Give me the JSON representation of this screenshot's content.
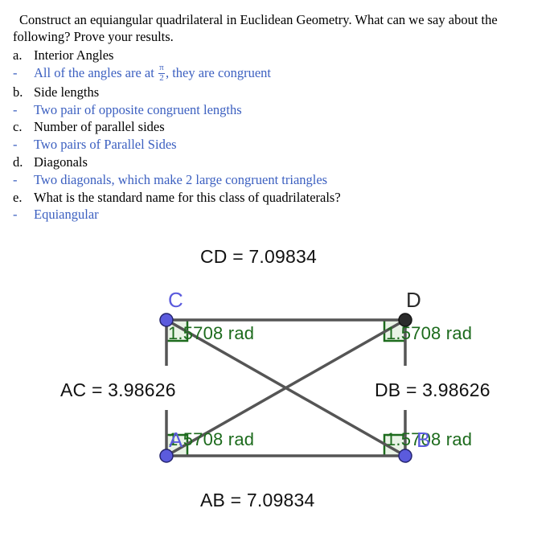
{
  "prompt": "Construct an equiangular quadrilateral in Euclidean Geometry.  What can we say about the following? Prove your results.",
  "qa": [
    {
      "marker": "a.",
      "kind": "question",
      "text": "Interior Angles"
    },
    {
      "marker": "-",
      "kind": "answer",
      "text_before": "All of the angles are at ",
      "fraction_num": "π",
      "fraction_den": "2",
      "text_after": ", they are congruent"
    },
    {
      "marker": "b.",
      "kind": "question",
      "text": "Side lengths"
    },
    {
      "marker": "-",
      "kind": "answer",
      "text": "Two pair of opposite congruent lengths"
    },
    {
      "marker": "c.",
      "kind": "question",
      "text": "Number of parallel sides"
    },
    {
      "marker": "-",
      "kind": "answer",
      "text": "Two pairs of Parallel Sides"
    },
    {
      "marker": "d.",
      "kind": "question",
      "text": "Diagonals"
    },
    {
      "marker": "-",
      "kind": "answer",
      "text": "Two diagonals, which make 2 large congruent triangles"
    },
    {
      "marker": "e.",
      "kind": "question",
      "text": "What is the standard name for this class of quadrilaterals?"
    },
    {
      "marker": "-",
      "kind": "answer",
      "text": "Equiangular"
    }
  ],
  "figure": {
    "measurements": {
      "cd": "CD = 7.09834",
      "ab": "AB = 7.09834",
      "ac": "AC = 3.98626",
      "db": "DB = 3.98626"
    },
    "angles": {
      "at_c": "1.5708 rad",
      "at_d": "1.5708 rad",
      "at_a": "1.5708 rad",
      "at_b": "1.5708 rad"
    },
    "points": {
      "a": "A",
      "b": "B",
      "c": "C",
      "d": "D"
    },
    "colors": {
      "point_blue": "#5b5bdd",
      "point_dark": "#2b2b2b",
      "angle_green": "#1d6b1d",
      "angle_fill": "#e9f3e6",
      "segment_gray": "#555555",
      "answer_blue": "#3b5fc0"
    }
  }
}
